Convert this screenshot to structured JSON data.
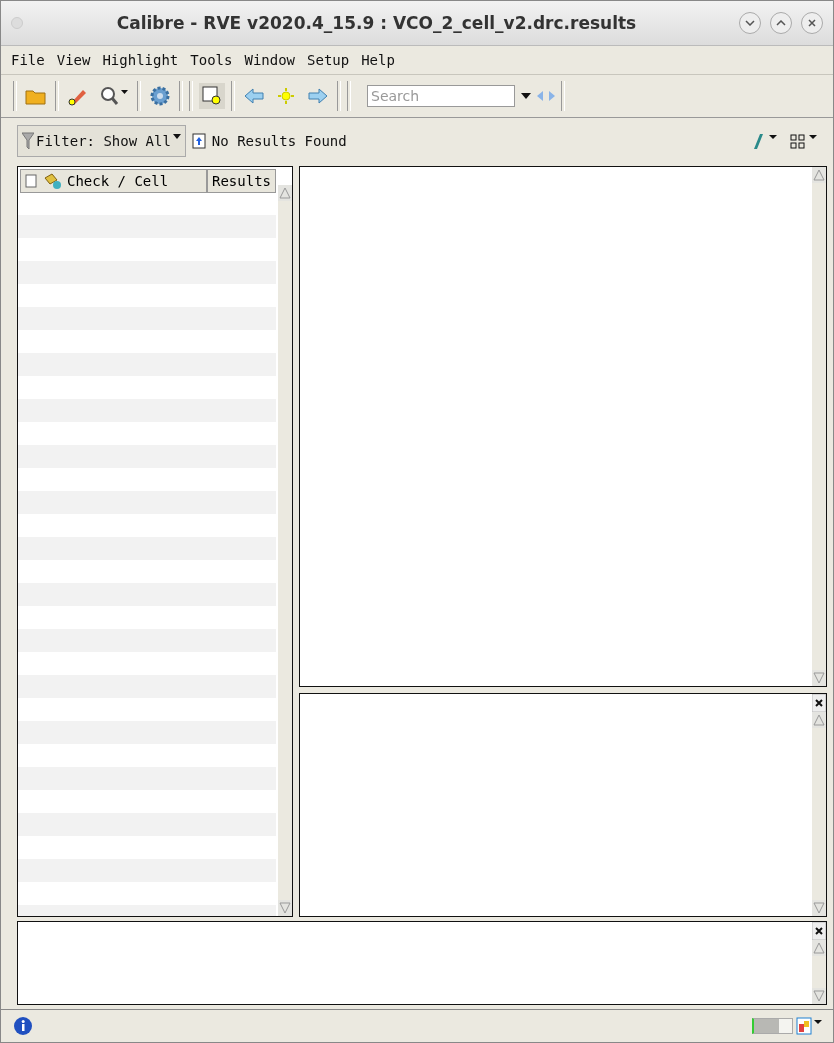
{
  "window": {
    "title": "Calibre - RVE v2020.4_15.9 : VCO_2_cell_v2.drc.results"
  },
  "menu": [
    "File",
    "View",
    "Highlight",
    "Tools",
    "Window",
    "Setup",
    "Help"
  ],
  "toolbar": {
    "search": {
      "placeholder": "Search"
    }
  },
  "filter_bar": {
    "filter": "Filter: Show All",
    "status": "No Results Found"
  },
  "results_tree": {
    "columns": [
      "Check / Cell",
      "Results"
    ]
  },
  "status_bar": {
    "memory": {
      "level": 0.65
    }
  }
}
